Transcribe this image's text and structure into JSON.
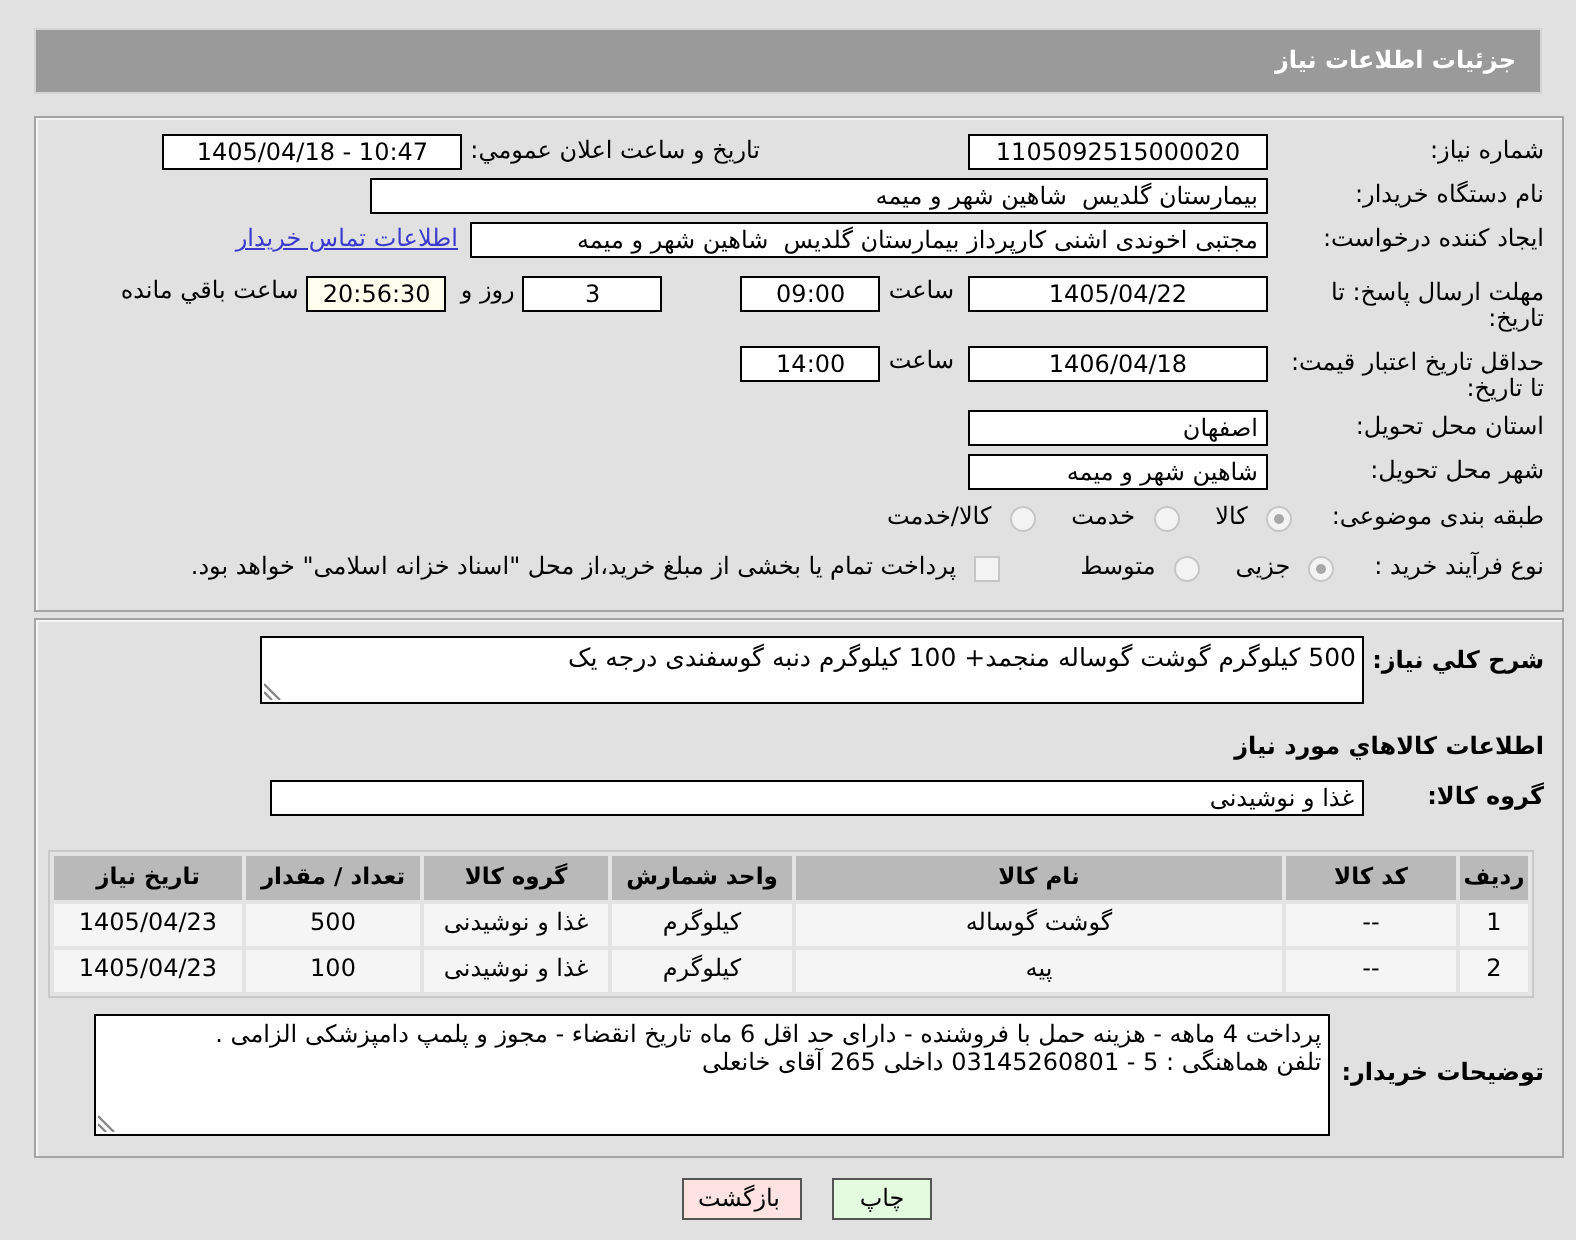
{
  "header": {
    "title": "جزئیات اطلاعات نیاز"
  },
  "details": {
    "number": {
      "label": "شماره نیاز:",
      "value": "1105092515000020"
    },
    "announcement": {
      "label": "تاریخ و ساعت اعلان عمومي:",
      "value": "1405/04/18 - 10:47"
    },
    "buyer": {
      "label": "نام دستگاه خریدار:",
      "value": "بیمارستان گلدیس  شاهین شهر و میمه"
    },
    "requester": {
      "label": "ایجاد کننده درخواست:",
      "value": "مجتبی اخوندی اشنی کارپرداز بیمارستان گلدیس  شاهین شهر و میمه",
      "contact_link": "اطلاعات تماس خریدار"
    },
    "reply_deadline": {
      "label": "مهلت ارسال پاسخ: تا تاریخ:",
      "date": "1405/04/22",
      "time_label": "ساعت",
      "time": "09:00",
      "days": "3",
      "days_label": "روز و",
      "remaining": "20:56:30",
      "remaining_label": "ساعت باقي مانده"
    },
    "price_validity": {
      "label": "حداقل تاریخ اعتبار قیمت: تا تاریخ:",
      "date": "1406/04/18",
      "time_label": "ساعت",
      "time": "14:00"
    },
    "province": {
      "label": "استان محل تحویل:",
      "value": "اصفهان"
    },
    "city": {
      "label": "شهر محل تحویل:",
      "value": "شاهین شهر و میمه"
    },
    "category": {
      "label": "طبقه بندی موضوعی:",
      "options": [
        {
          "label": "کالا",
          "selected": true
        },
        {
          "label": "خدمت",
          "selected": false
        },
        {
          "label": "کالا/خدمت",
          "selected": false
        }
      ]
    },
    "purchase_type": {
      "label": "نوع فرآیند خرید :",
      "options": [
        {
          "label": "جزیی",
          "selected": true
        },
        {
          "label": "متوسط",
          "selected": false
        }
      ],
      "treasury": {
        "label": "پرداخت تمام یا بخشی از مبلغ خرید،از محل \"اسناد خزانه اسلامی\" خواهد بود.",
        "checked": false
      }
    }
  },
  "need": {
    "description": {
      "label": "شرح کلي نیاز:",
      "value": "500 کیلوگرم گوشت گوساله منجمد+ 100 کیلوگرم دنبه گوسفندی درجه یک"
    },
    "items_heading": "اطلاعات کالاهاي مورد نیاز",
    "goods_group": {
      "label": "گروه کالا:",
      "value": "غذا و نوشیدنی"
    },
    "table": {
      "columns": [
        "ردیف",
        "کد کالا",
        "نام کالا",
        "واحد شمارش",
        "گروه کالا",
        "تعداد / مقدار",
        "تاریخ نیاز"
      ],
      "rows": [
        [
          "1",
          "--",
          "گوشت گوساله",
          "کیلوگرم",
          "غذا و نوشیدنی",
          "500",
          "1405/04/23"
        ],
        [
          "2",
          "--",
          "پیه",
          "کیلوگرم",
          "غذا و نوشیدنی",
          "100",
          "1405/04/23"
        ]
      ]
    },
    "buyer_notes": {
      "label": "توضیحات خریدار:",
      "lines": [
        "پرداخت 4 ماهه - هزینه حمل با فروشنده - دارای حد اقل 6 ماه تاریخ انقضاء - مجوز و پلمپ دامپزشکی الزامی .",
        "تلفن هماهنگی : 5 - 03145260801 داخلی 265 آقای خانعلی"
      ]
    }
  },
  "buttons": [
    {
      "label": "چاپ",
      "kind": "print"
    },
    {
      "label": "بازگشت",
      "kind": "back"
    }
  ]
}
